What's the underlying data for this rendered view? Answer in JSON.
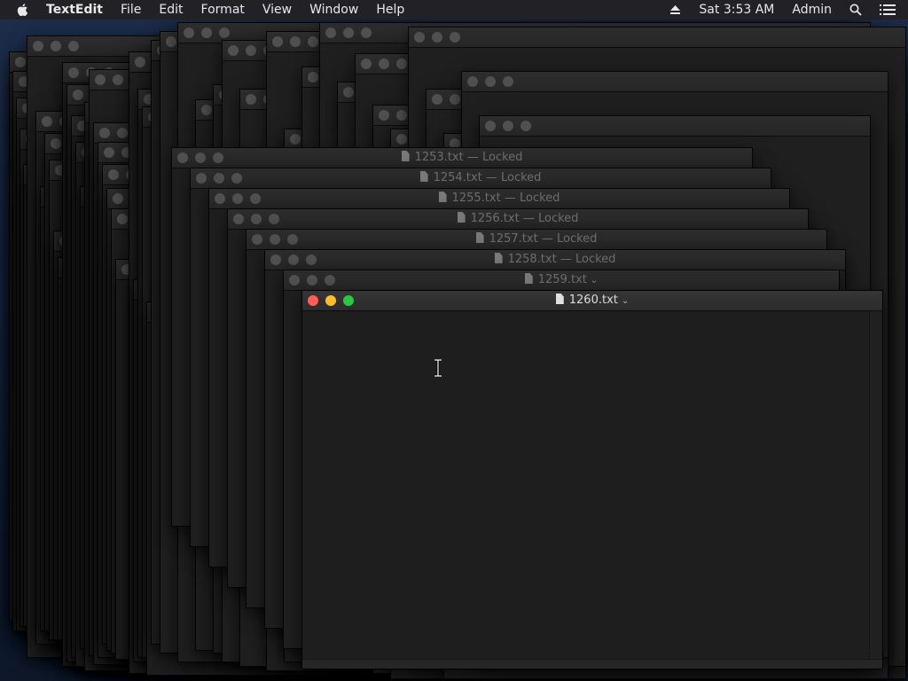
{
  "menubar": {
    "app_name": "TextEdit",
    "menus": [
      "File",
      "Edit",
      "Format",
      "View",
      "Window",
      "Help"
    ],
    "clock": "Sat 3:53 AM",
    "user": "Admin",
    "icons": [
      "apple-icon",
      "eject-icon",
      "search-icon",
      "list-icon"
    ]
  },
  "windows": [
    {
      "title": "1253.txt",
      "status": "— Locked"
    },
    {
      "title": "1254.txt",
      "status": "— Locked"
    },
    {
      "title": "1255.txt",
      "status": "— Locked"
    },
    {
      "title": "1256.txt",
      "status": "— Locked"
    },
    {
      "title": "1257.txt",
      "status": "— Locked"
    },
    {
      "title": "1258.txt",
      "status": "— Locked"
    },
    {
      "title": "1259.txt",
      "status": ""
    }
  ],
  "front_window": {
    "title": "1260.txt",
    "content": ""
  }
}
